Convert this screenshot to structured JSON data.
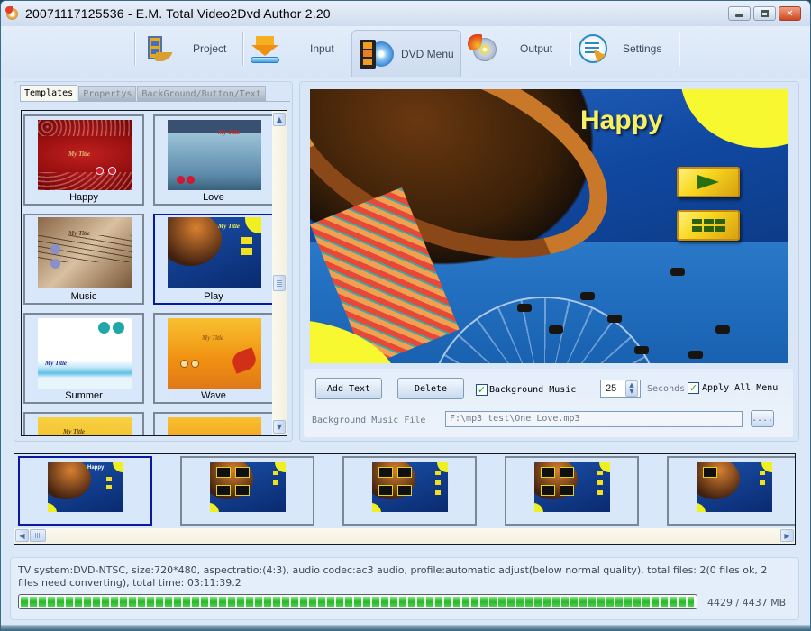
{
  "window": {
    "title": "20071117125536 - E.M. Total Video2Dvd Author 2.20",
    "controls": {
      "minimize": "minimize-icon",
      "maximize": "maximize-icon",
      "close": "close-icon"
    }
  },
  "nav": {
    "items": [
      {
        "id": "project",
        "label": "Project",
        "accel": "P",
        "icon": "project-film-icon",
        "active": false
      },
      {
        "id": "input",
        "label": "Input",
        "accel": "I",
        "icon": "input-download-icon",
        "active": false
      },
      {
        "id": "dvd_menu",
        "label": "DVD Menu",
        "accel": "M",
        "icon": "dvd-menu-icon",
        "active": true
      },
      {
        "id": "output",
        "label": "Output",
        "accel": "u",
        "icon": "burn-disc-icon",
        "active": false
      },
      {
        "id": "settings",
        "label": "Settings",
        "accel": "e",
        "icon": "settings-list-icon",
        "active": false
      }
    ]
  },
  "left_panel": {
    "tabs": [
      {
        "label": "Templates",
        "active": true
      },
      {
        "label": "Propertys",
        "active": false
      },
      {
        "label": "BackGround/Button/Text",
        "active": false
      }
    ],
    "templates": [
      {
        "name": "Happy",
        "thumb_title": "My Title",
        "selected": false
      },
      {
        "name": "Love",
        "thumb_title": "My Title",
        "selected": false
      },
      {
        "name": "Music",
        "thumb_title": "My Title",
        "selected": false
      },
      {
        "name": "Play",
        "thumb_title": "My Title",
        "selected": true
      },
      {
        "name": "Summer",
        "thumb_title": "My Title",
        "selected": false
      },
      {
        "name": "Wave",
        "thumb_title": "My Title",
        "selected": false
      },
      {
        "name": "",
        "thumb_title": "My Title",
        "selected": false
      },
      {
        "name": "",
        "thumb_title": "",
        "selected": false
      }
    ]
  },
  "preview": {
    "title": "Happy",
    "buttons": [
      "play-button-icon",
      "chapters-grid-icon"
    ]
  },
  "controls": {
    "add_text_label": "Add Text",
    "delete_label": "Delete",
    "background_music_label": "Background Music",
    "background_music_checked": true,
    "seconds_value": "25",
    "seconds_label": "Seconds",
    "apply_all_label": "Apply All Menu",
    "apply_all_checked": true,
    "music_file_label": "Background Music File",
    "music_file_value": "F:\\mp3 test\\One Love.mp3",
    "browse_label": "...."
  },
  "filmstrip": {
    "frames": [
      {
        "title": "Happy",
        "selected": true,
        "type": "main"
      },
      {
        "title": "",
        "selected": false,
        "type": "chapters4"
      },
      {
        "title": "",
        "selected": false,
        "type": "chapters4"
      },
      {
        "title": "",
        "selected": false,
        "type": "chapters4"
      },
      {
        "title": "",
        "selected": false,
        "type": "chapters1"
      }
    ]
  },
  "status": {
    "text": "TV system:DVD-NTSC, size:720*480, aspectratio:(4:3), audio codec:ac3 audio, profile:automatic adjust(below normal quality), total files: 2(0 files ok, 2 files need converting), total time: 03:11:39.2",
    "used_mb": 4429,
    "capacity_mb": 4437,
    "readout": "4429 / 4437 MB",
    "progress_fraction": 0.998
  }
}
